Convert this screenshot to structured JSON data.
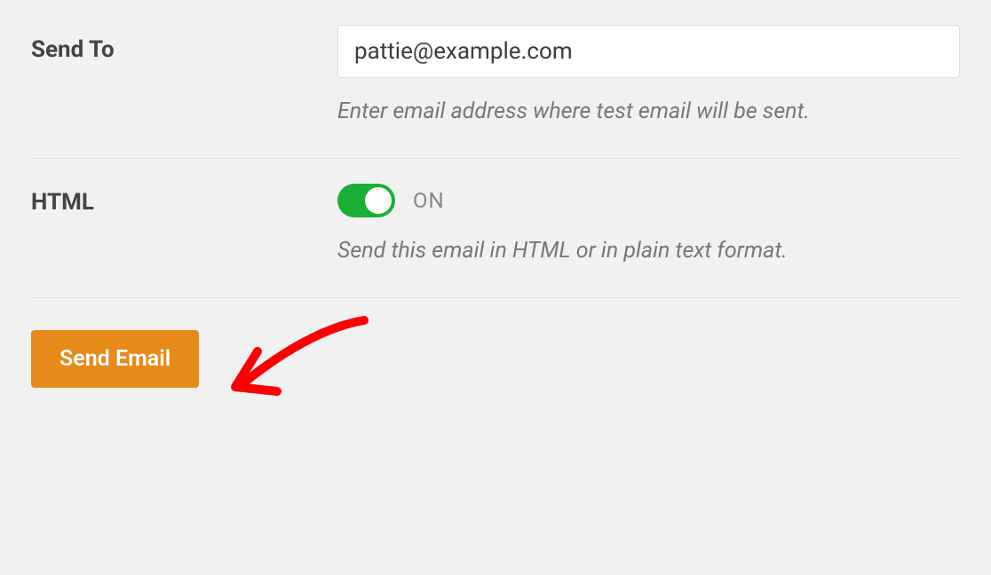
{
  "send_to": {
    "label": "Send To",
    "value": "pattie@example.com",
    "helper": "Enter email address where test email will be sent."
  },
  "html_toggle": {
    "label": "HTML",
    "state_label": "ON",
    "on": true,
    "helper": "Send this email in HTML or in plain text format."
  },
  "send_button": {
    "label": "Send Email"
  }
}
